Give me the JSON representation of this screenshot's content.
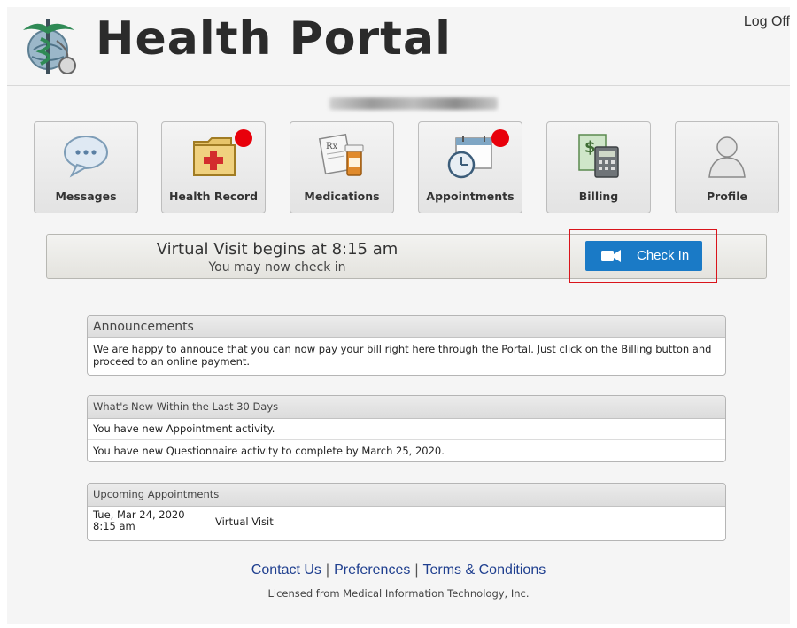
{
  "header": {
    "title": "Health Portal",
    "logoff": "Log Off"
  },
  "tiles": [
    {
      "label": "Messages",
      "icon": "chat-bubble-icon",
      "badge": false
    },
    {
      "label": "Health Record",
      "icon": "medical-folder-icon",
      "badge": true
    },
    {
      "label": "Medications",
      "icon": "prescription-icon",
      "badge": false
    },
    {
      "label": "Appointments",
      "icon": "calendar-clock-icon",
      "badge": true
    },
    {
      "label": "Billing",
      "icon": "calculator-money-icon",
      "badge": false
    },
    {
      "label": "Profile",
      "icon": "user-icon",
      "badge": false
    }
  ],
  "virtual_visit": {
    "title": "Virtual Visit begins at 8:15 am",
    "subtitle": "You may now check in",
    "button": "Check In"
  },
  "announcements": {
    "title": "Announcements",
    "text": "We are happy to annouce that you can now pay your bill right here through the Portal. Just click on the Billing button and proceed to an online payment."
  },
  "whats_new": {
    "title": "What's New Within the Last 30 Days",
    "items": [
      "You have new Appointment activity.",
      "You have new Questionnaire activity to complete by March 25, 2020."
    ]
  },
  "upcoming": {
    "title": "Upcoming Appointments",
    "items": [
      {
        "date": "Tue, Mar 24, 2020",
        "time": "8:15 am",
        "type": "Virtual Visit"
      }
    ]
  },
  "footer": {
    "links": [
      "Contact Us",
      "Preferences",
      "Terms & Conditions"
    ],
    "license": "Licensed from Medical Information Technology, Inc."
  },
  "colors": {
    "accent": "#1a7ac6",
    "badge": "#e8000b",
    "highlight": "#d9141b",
    "link": "#1f3f8f"
  }
}
